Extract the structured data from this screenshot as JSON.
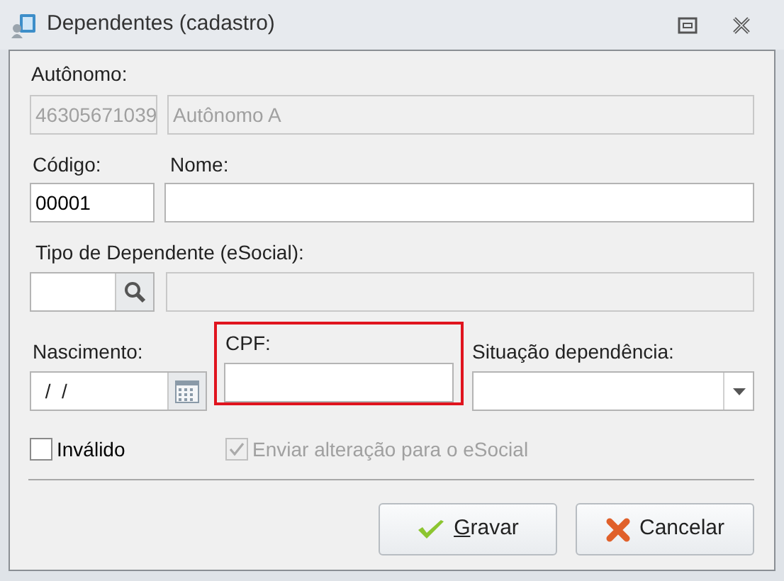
{
  "window": {
    "title": "Dependentes (cadastro)"
  },
  "autonomo": {
    "label": "Autônomo:",
    "code": {
      "value": "46305671039",
      "disabled": true
    },
    "name": {
      "value": "Autônomo A",
      "disabled": true
    }
  },
  "codigo": {
    "label": "Código:",
    "value": "00001"
  },
  "nome": {
    "label": "Nome:"
  },
  "tipo_dependente": {
    "label": "Tipo de Dependente (eSocial):",
    "description": {
      "disabled": true
    }
  },
  "nascimento": {
    "label": "Nascimento:",
    "value": " /  /"
  },
  "cpf": {
    "label": "CPF:",
    "highlighted": true
  },
  "situacao": {
    "label": "Situação dependência:"
  },
  "checkboxes": [
    {
      "label": "Inválido",
      "checked": false,
      "disabled": false
    },
    {
      "label": "Enviar alteração para o eSocial",
      "checked": true,
      "disabled": true
    }
  ],
  "buttons": [
    {
      "label": "Gravar",
      "kind": "ok",
      "mnemonic": true
    },
    {
      "label": "Cancelar",
      "kind": "cancel",
      "mnemonic": false
    }
  ]
}
